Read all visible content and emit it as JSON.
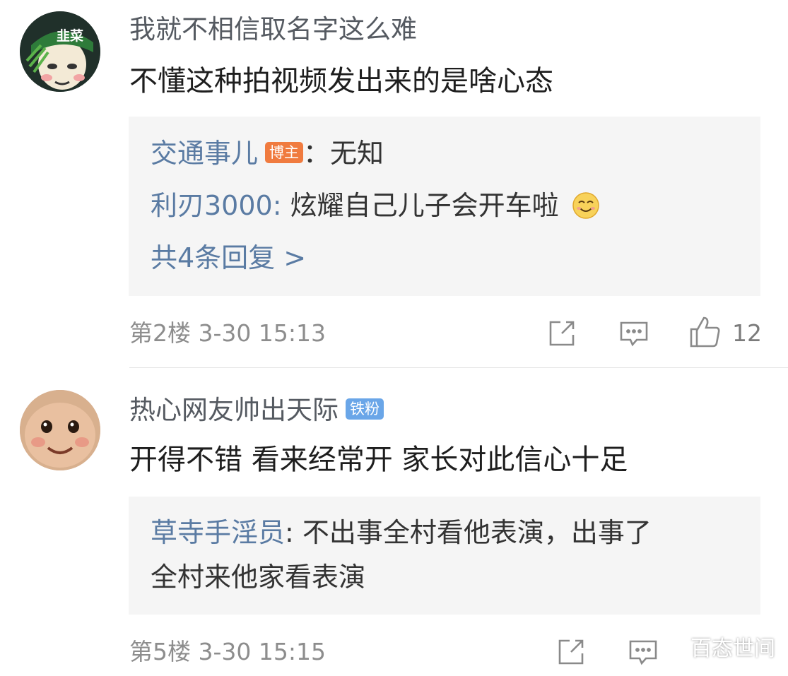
{
  "comments": [
    {
      "username": "我就不相信取名字这么难",
      "avatar_text": "韭菜",
      "content": "不懂这种拍视频发出来的是啥心态",
      "replies": [
        {
          "user": "交通事儿",
          "badge": "博主",
          "separator": "：",
          "text": "无知"
        },
        {
          "user": "利刃3000",
          "separator": ":",
          "text": "炫耀自己儿子会开车啦"
        }
      ],
      "more_replies": "共4条回复 >",
      "floor": "第2楼",
      "time": "3-30 15:13",
      "like_count": "12"
    },
    {
      "username": "热心网友帅出天际",
      "badge": "铁粉",
      "content": "开得不错 看来经常开 家长对此信心十足",
      "replies": [
        {
          "user": "草寺手淫员",
          "separator": ":",
          "text": "不出事全村看他表演，出事了",
          "text_line2": "全村来他家看表演"
        }
      ],
      "floor": "第5楼",
      "time": "3-30 15:15"
    }
  ],
  "icons": {
    "share": "share-icon",
    "comment": "comment-icon",
    "like": "like-icon",
    "emoji": "smile-emoji-icon"
  },
  "colors": {
    "link": "#5a7ba3",
    "author_badge": "#f07b3f",
    "fan_badge": "#6aa6e8",
    "reply_bg": "#f5f5f5"
  },
  "watermark": "百态世间"
}
